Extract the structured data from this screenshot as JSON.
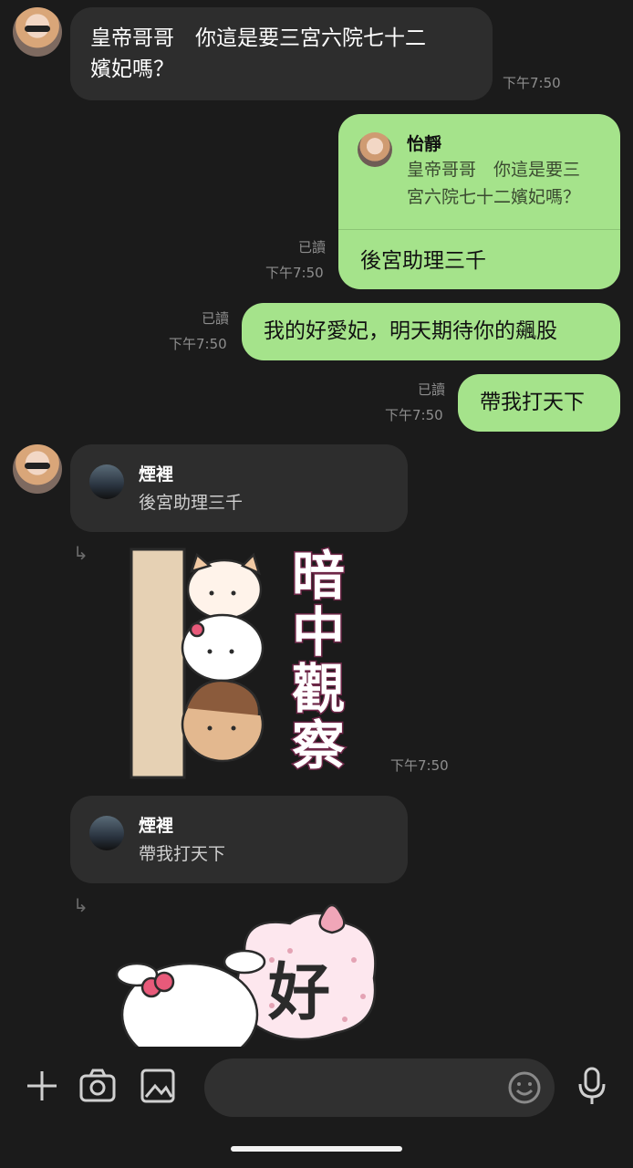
{
  "messages": [
    {
      "id": "m1",
      "text_line1": "皇帝哥哥　你這是要三宮六院七十二",
      "text_line2": "嬪妃嗎？",
      "time": "下午7:50"
    },
    {
      "id": "m2",
      "reply_to_name": "怡靜",
      "reply_to_line1": "皇帝哥哥　你這是要三",
      "reply_to_line2": "宮六院七十二嬪妃嗎？",
      "text": "後宮助理三千",
      "read": "已讀",
      "time": "下午7:50"
    },
    {
      "id": "m3",
      "text": "我的好愛妃，明天期待你的飆股",
      "read": "已讀",
      "time": "下午7:50"
    },
    {
      "id": "m4",
      "text": "帶我打天下",
      "read": "已讀",
      "time": "下午7:50"
    },
    {
      "id": "m5",
      "reply_to_name": "煙裡",
      "reply_to_text": "後宮助理三千"
    },
    {
      "id": "m6",
      "sticker_text": "暗中觀察",
      "time": "下午7:50"
    },
    {
      "id": "m7",
      "reply_to_name": "煙裡",
      "reply_to_text": "帶我打天下"
    },
    {
      "id": "m8",
      "sticker_text": "好"
    }
  ],
  "icons": {
    "add": "plus-icon",
    "camera": "camera-icon",
    "image": "image-icon",
    "emoji": "emoji-icon",
    "mic": "microphone-icon",
    "reply": "reply-arrow-icon"
  },
  "colors": {
    "outgoing": "#a5e38b",
    "incoming": "#2d2d2d",
    "background": "#1b1b1b"
  }
}
